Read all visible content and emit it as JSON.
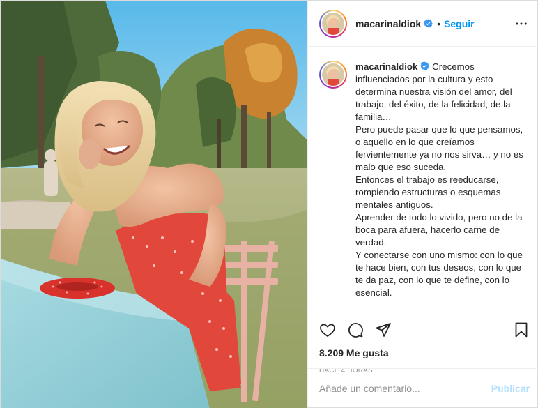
{
  "post": {
    "username": "macarinaldiok",
    "verified": true,
    "follow_label": "Seguir",
    "separator": "•",
    "more_icon": "more-horizontal-icon",
    "photo_description_icon": "photo"
  },
  "caption": {
    "username": "macarinaldiok",
    "paragraphs": [
      "Crecemos influenciados por la cultura y esto determina nuestra visión del amor, del trabajo, del éxito, de la felicidad, de la familia…",
      "Pero puede pasar que lo que pensamos, o aquello en lo que creíamos fervientemente ya no nos sirva… y no es malo que eso suceda.",
      "Entonces el trabajo es reeducarse, rompiendo estructuras o esquemas mentales antiguos.",
      "Aprender de todo lo vivido, pero no de la boca para afuera, hacerlo carne de verdad.",
      "Y conectarse con uno mismo: con lo que te hace bien, con tus deseos, con lo que te da paz, con lo que te define, con lo esencial."
    ]
  },
  "actions": {
    "like_icon": "heart-icon",
    "comment_icon": "comment-icon",
    "share_icon": "share-icon",
    "save_icon": "bookmark-icon"
  },
  "stats": {
    "likes": "8.209 Me gusta",
    "time": "HACE 4 HORAS"
  },
  "comment": {
    "placeholder": "Añade un comentario...",
    "publish_label": "Publicar"
  },
  "colors": {
    "accent": "#0095f6",
    "publish_disabled": "#b2dffc",
    "verified": "#3897f0",
    "text": "#262626",
    "muted": "#8e8e8e"
  }
}
